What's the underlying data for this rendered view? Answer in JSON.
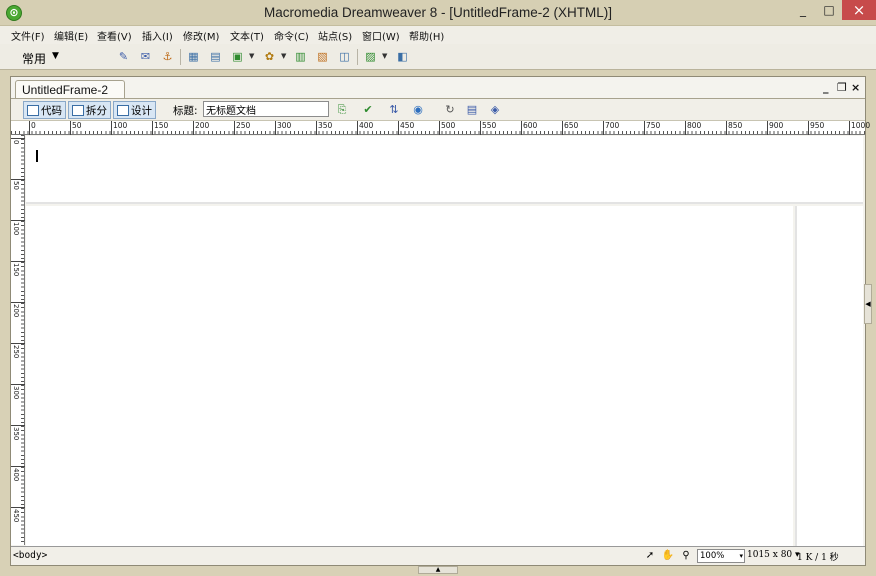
{
  "window": {
    "title": "Macromedia Dreamweaver 8 - [UntitledFrame-2 (XHTML)]",
    "logo_glyph": "⊙",
    "minimize_glyph": "_",
    "maximize_glyph": "□",
    "close_glyph": "×"
  },
  "menu": {
    "items": [
      "文件(F)",
      "编辑(E)",
      "查看(V)",
      "插入(I)",
      "修改(M)",
      "文本(T)",
      "命令(C)",
      "站点(S)",
      "窗口(W)",
      "帮助(H)"
    ]
  },
  "insert_bar": {
    "category": "常用",
    "caret": "▼",
    "buttons": [
      {
        "icon": "hyperlink-icon",
        "glyph": "✎",
        "color": "#3a5aa8"
      },
      {
        "icon": "email-link-icon",
        "glyph": "✉",
        "color": "#3a5aa8"
      },
      {
        "icon": "named-anchor-icon",
        "glyph": "⚓",
        "color": "#c07020"
      },
      {
        "icon": "table-icon",
        "glyph": "▦",
        "color": "#3a6ea5"
      },
      {
        "icon": "layer-icon",
        "glyph": "▤",
        "color": "#3a6ea5"
      },
      {
        "icon": "image-icon",
        "glyph": "▣",
        "color": "#2e8b2e"
      },
      {
        "icon": "media-icon",
        "glyph": "✿",
        "color": "#b07a10"
      },
      {
        "icon": "date-icon",
        "glyph": "▥",
        "color": "#2e8b2e"
      },
      {
        "icon": "server-include-icon",
        "glyph": "▧",
        "color": "#c07020"
      },
      {
        "icon": "comment-icon",
        "glyph": "◫",
        "color": "#3a6ea5"
      },
      {
        "icon": "templates-icon",
        "glyph": "▨",
        "color": "#2e8b2e"
      },
      {
        "icon": "tag-chooser-icon",
        "glyph": "◧",
        "color": "#3a6ea5"
      }
    ]
  },
  "document": {
    "tab_label": "UntitledFrame-2",
    "doc_min_glyph": "_",
    "doc_restore_glyph": "❐",
    "doc_close_glyph": "×",
    "view_buttons": {
      "code": "代码",
      "split": "拆分",
      "design": "设计"
    },
    "title_label": "标题:",
    "title_value": "无标题文档",
    "toolbar_icons": [
      {
        "icon": "browser-compat-icon",
        "glyph": "⎘",
        "color": "#2e8b2e"
      },
      {
        "icon": "validate-icon",
        "glyph": "✔",
        "color": "#2e8b2e"
      },
      {
        "icon": "file-management-icon",
        "glyph": "⇅",
        "color": "#3a5aa8"
      },
      {
        "icon": "preview-browser-icon",
        "glyph": "◉",
        "color": "#2e6fbf"
      },
      {
        "icon": "refresh-icon",
        "glyph": "↻",
        "color": "#555555"
      },
      {
        "icon": "view-options-icon",
        "glyph": "▤",
        "color": "#3a5aa8"
      },
      {
        "icon": "visual-aids-icon",
        "glyph": "◈",
        "color": "#3a5aa8"
      }
    ]
  },
  "ruler": {
    "h_labels": [
      "0",
      "50",
      "100",
      "150",
      "200",
      "250",
      "300",
      "350",
      "400",
      "450",
      "500",
      "550",
      "600",
      "650",
      "700",
      "750",
      "800",
      "850",
      "900",
      "950",
      "1000"
    ],
    "v_labels": [
      "0",
      "50",
      "100",
      "150",
      "200",
      "250",
      "300",
      "350",
      "400",
      "450"
    ]
  },
  "status": {
    "tag": "<body>",
    "zoom": "100%",
    "zoom_caret": "▾",
    "window_size": "1015 x 80",
    "window_size_caret": "▾",
    "download_stats": "1 K / 1 秒",
    "icons": [
      {
        "icon": "select-tool-icon",
        "glyph": "➚"
      },
      {
        "icon": "hand-tool-icon",
        "glyph": "✋"
      },
      {
        "icon": "zoom-tool-icon",
        "glyph": "⚲"
      }
    ]
  },
  "expanders": {
    "right_glyph": "◀",
    "bottom_glyph": "▲"
  }
}
